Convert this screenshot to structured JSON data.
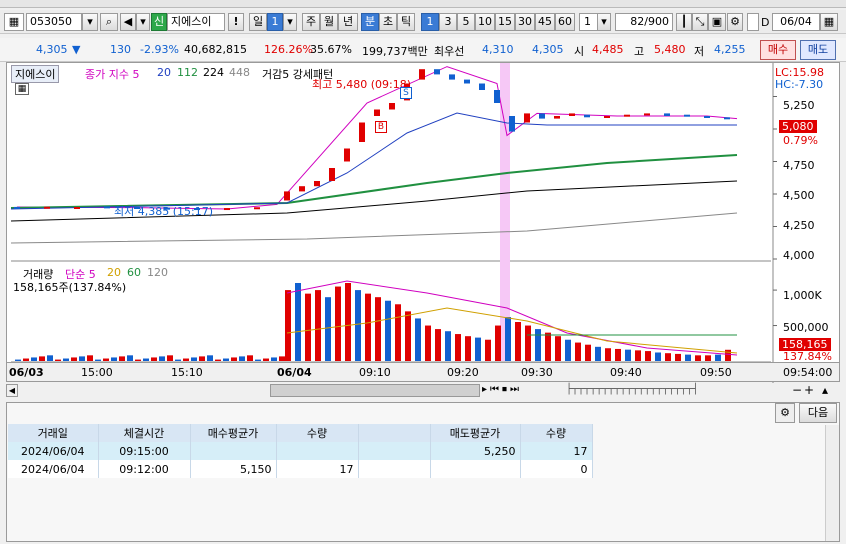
{
  "toolbar": {
    "code": "053050",
    "name": "지에스이",
    "name_badge": "신",
    "warning": "!",
    "periods": [
      "일",
      "1",
      "주",
      "월",
      "년",
      "분",
      "초",
      "틱"
    ],
    "minutes": [
      "1",
      "3",
      "5",
      "10",
      "15",
      "30",
      "45",
      "60"
    ],
    "interval": "1",
    "count": "82/900",
    "date": "06/04",
    "date_label": "D"
  },
  "info": {
    "price": "4,305",
    "change_arrow": "▼",
    "change": "130",
    "change_pct": "-2.93%",
    "volume": "40,682,815",
    "vol_ratio": "126.26%",
    "turnover_pct": "35.67%",
    "amount": "199,737백만",
    "priority_label": "최우선",
    "bid": "4,310",
    "ask": "4,305",
    "open_label": "시",
    "open": "4,485",
    "high_label": "고",
    "high": "5,480",
    "low_label": "저",
    "low": "4,255",
    "buy_button": "매수",
    "sell_button": "매도"
  },
  "chart": {
    "name_tag": "지에스이",
    "legend_price": [
      "종가 지수 5",
      "20",
      "112",
      "224",
      "448"
    ],
    "pattern": "거감5 강세패턴",
    "high_note": "최고 5,480 (09:18)",
    "low_note": "최저 4,385 (15:17)",
    "lc": "LC:15.98",
    "hc": "HC:-7.30",
    "y_labels": [
      "5,250",
      "5,000",
      "4,750",
      "4,500",
      "4,250",
      "4,000"
    ],
    "current_price": "5,080",
    "current_pct": "0.79%",
    "markers": [
      "B",
      "S"
    ],
    "volume_legend": [
      "거래량",
      "단순 5",
      "20",
      "60",
      "120"
    ],
    "volume_value": "158,165주(137.84%)",
    "vol_y_labels": [
      "1,000K",
      "500,000"
    ],
    "vol_current": "158,165",
    "vol_pct": "137.84%",
    "time_labels": [
      "06/03",
      "15:00",
      "15:10",
      "06/04",
      "09:10",
      "09:20",
      "09:30",
      "09:40",
      "09:50",
      "09:54:00"
    ]
  },
  "chart_data": {
    "type": "line",
    "title": "",
    "x": [
      "15:00",
      "15:10",
      "15:17",
      "06/04 09:00",
      "09:10",
      "09:18",
      "09:20",
      "09:25",
      "09:30",
      "09:40",
      "09:50",
      "09:54"
    ],
    "series": [
      {
        "name": "종가",
        "values": [
          4400,
          4395,
          4385,
          4420,
          5200,
          5480,
          5350,
          4950,
          5120,
          5100,
          5100,
          5080
        ]
      }
    ],
    "ylim": [
      4000,
      5400
    ],
    "y_ticks": [
      4000,
      4250,
      4500,
      4750,
      5000,
      5250
    ],
    "volume_ticks": [
      500000,
      1000000
    ]
  },
  "grid": {
    "headers": [
      "거래일",
      "체결시간",
      "매수평균가",
      "수량",
      "",
      "매도평균가",
      "수량"
    ],
    "rows": [
      [
        "2024/06/04",
        "09:15:00",
        "",
        "",
        "",
        "5,250",
        "17"
      ],
      [
        "2024/06/04",
        "09:12:00",
        "5,150",
        "17",
        "",
        "",
        "0"
      ]
    ],
    "next_button": "다음"
  },
  "colors": {
    "up": "#e00000",
    "down": "#1060d0",
    "accent": "#3a7bd5"
  }
}
